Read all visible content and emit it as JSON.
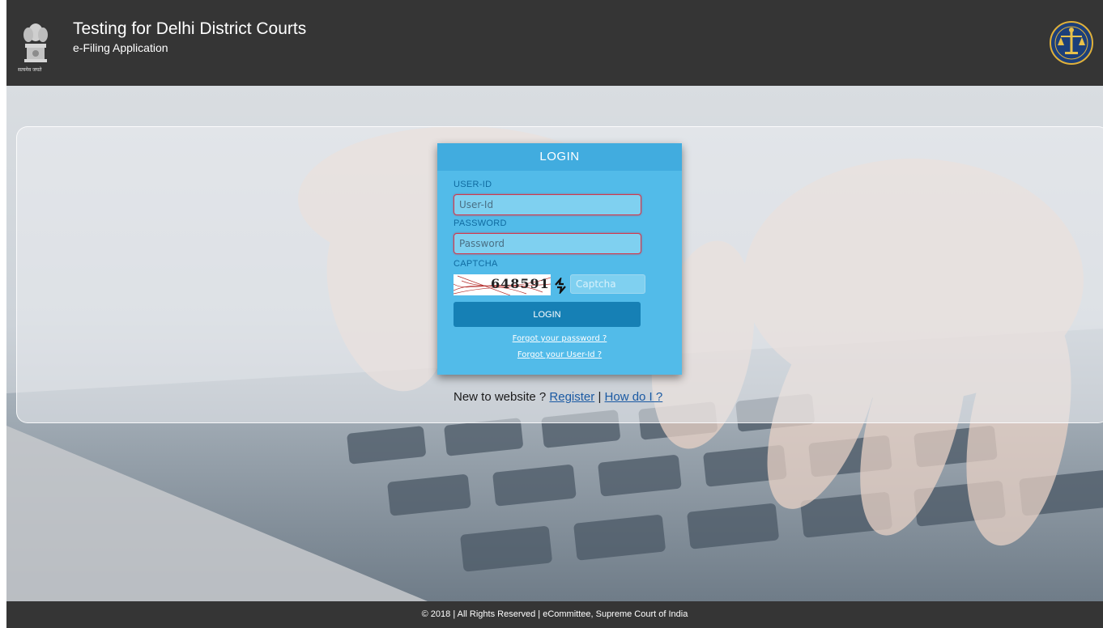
{
  "header": {
    "title": "Testing for Delhi District Courts",
    "subtitle": "e-Filing Application",
    "emblem_motto": "सत्यमेव जयते"
  },
  "login": {
    "heading": "LOGIN",
    "userid_label": "USER-ID",
    "userid_placeholder": "User-Id",
    "password_label": "PASSWORD",
    "password_placeholder": "Password",
    "captcha_label": "CAPTCHA",
    "captcha_text": "648591",
    "captcha_placeholder": "Captcha",
    "login_button": "LOGIN",
    "forgot_password": "Forgot your password ?",
    "forgot_userid": "Forgot your User-Id ?"
  },
  "register": {
    "prompt": "New to website ?",
    "register_link": "Register",
    "separator": "|",
    "howdoi_link": "How do I ?"
  },
  "footer": {
    "text": "© 2018 | All Rights Reserved | eCommittee, Supreme Court of India"
  },
  "colors": {
    "header_bg": "#353535",
    "card_bg": "#52bbe9",
    "card_header": "#41acdf",
    "login_button": "#1680b5",
    "input_border_error": "#d2384b"
  },
  "icons": [
    "national-emblem-icon",
    "supreme-court-logo-icon",
    "captcha-refresh-icon"
  ]
}
